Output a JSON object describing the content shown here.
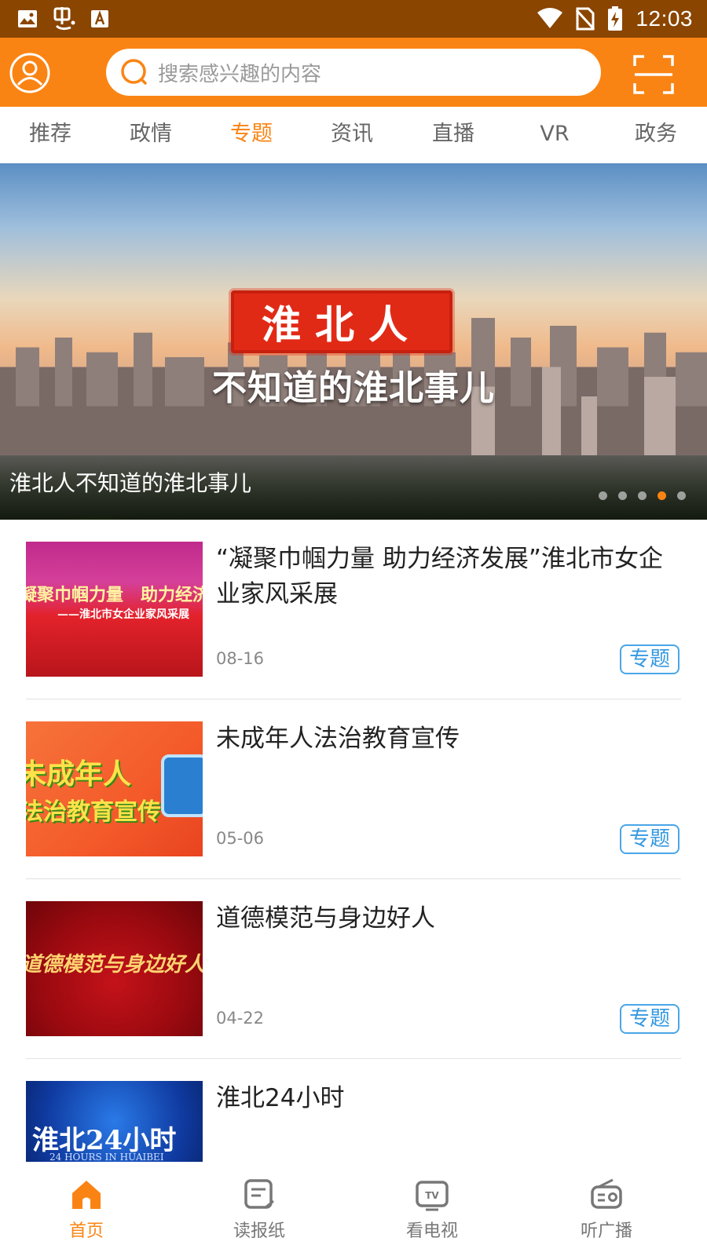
{
  "status_bar": {
    "time": "12:03"
  },
  "header": {
    "search_placeholder": "搜索感兴趣的内容"
  },
  "tabs": [
    {
      "label": "推荐"
    },
    {
      "label": "政情"
    },
    {
      "label": "专题",
      "active": true
    },
    {
      "label": "资讯"
    },
    {
      "label": "直播"
    },
    {
      "label": "VR"
    },
    {
      "label": "政务"
    }
  ],
  "banner": {
    "seal_text": "淮北人",
    "subtitle": "不知道的淮北事儿",
    "caption": "淮北人不知道的淮北事儿",
    "slide_count": 5,
    "active_slide": 4
  },
  "articles": [
    {
      "title": "“凝聚巾帼力量 助力经济发展”淮北市女企业家风采展",
      "date": "08-16",
      "tag": "专题",
      "thumb_text": "凝聚巾帼力量　助力经济发展",
      "thumb_sub": "——淮北市女企业家风采展"
    },
    {
      "title": "未成年人法治教育宣传",
      "date": "05-06",
      "tag": "专题",
      "thumb_text": "未成年人",
      "thumb_sub": "法治教育宣传"
    },
    {
      "title": "道德模范与身边好人",
      "date": "04-22",
      "tag": "专题",
      "thumb_text": "道德模范与身边好人"
    },
    {
      "title": "淮北24小时",
      "thumb_text": "淮北24小时",
      "thumb_sub": "24 HOURS IN HUAIBEI"
    }
  ],
  "bottom_nav": [
    {
      "label": "首页",
      "icon": "home-icon",
      "active": true
    },
    {
      "label": "读报纸",
      "icon": "newspaper-icon"
    },
    {
      "label": "看电视",
      "icon": "tv-icon"
    },
    {
      "label": "听广播",
      "icon": "radio-icon"
    }
  ],
  "colors": {
    "brand": "#fa8413",
    "status_bar": "#8a4500",
    "tag_blue": "#3598e0"
  }
}
